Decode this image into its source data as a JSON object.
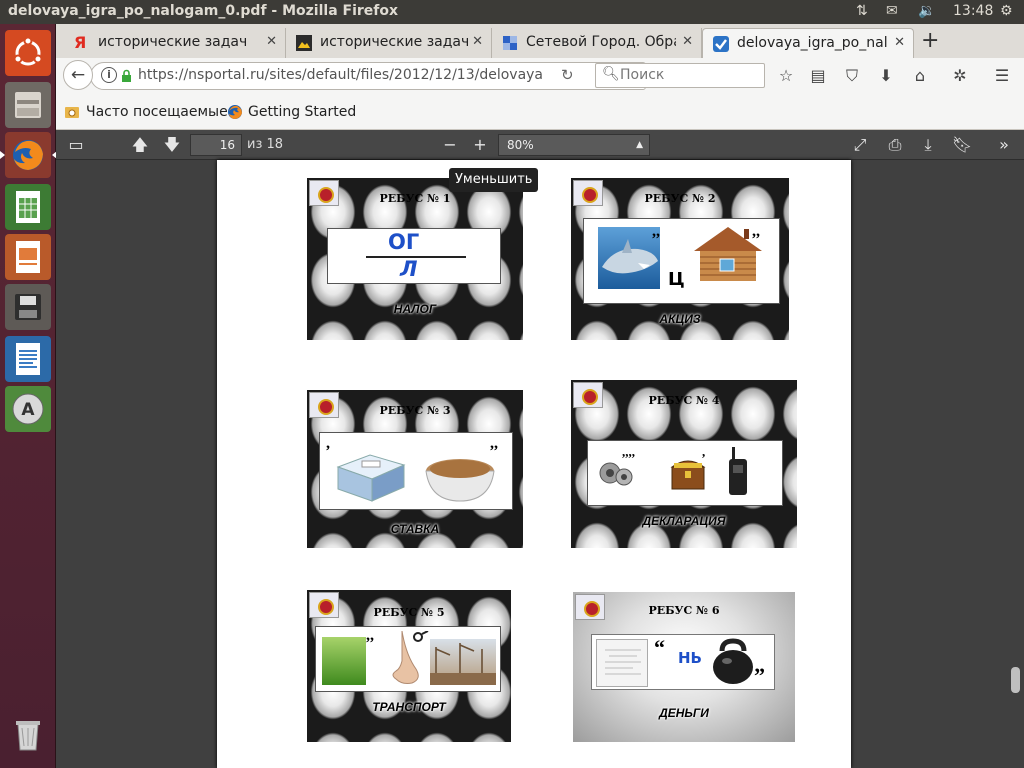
{
  "top_panel": {
    "window_title": "delovaya_igra_po_nalogam_0.pdf - Mozilla Firefox",
    "time": "13:48"
  },
  "launcher": {
    "items": [
      "ubuntu-dash",
      "files",
      "firefox",
      "libreoffice-calc",
      "libreoffice-impress",
      "save-disk",
      "libreoffice-writer",
      "software-updater",
      "trash"
    ]
  },
  "tabs": [
    {
      "label": "исторические задачи",
      "favicon": "yandex-icon"
    },
    {
      "label": "исторические задачи",
      "favicon": "image-icon"
    },
    {
      "label": "Сетевой Город. Образ",
      "favicon": "netcity-icon"
    },
    {
      "label": "delovaya_igra_po_nalo",
      "favicon": "pdf-check-icon",
      "active": true
    }
  ],
  "navbar": {
    "url": "https://nsportal.ru/sites/default/files/2012/12/13/delovaya",
    "search_placeholder": "Поиск"
  },
  "bookmarks": {
    "items": [
      {
        "label": "Часто посещаемые",
        "icon": "gear-folder-icon"
      },
      {
        "label": "Getting Started",
        "icon": "firefox-icon"
      }
    ]
  },
  "pdf_toolbar": {
    "page_number": "16",
    "page_total": "из 18",
    "zoom": "80%"
  },
  "tooltip": "Уменьшить",
  "slides": [
    {
      "title": "РЕБУС № 1",
      "answer": "НАЛОГ",
      "top_text": "ОГ",
      "bottom_text": "Л"
    },
    {
      "title": "РЕБУС № 2",
      "answer": "АКЦИЗ",
      "letter": "Ц",
      "comma_left": ",,",
      "comma_right": ",,"
    },
    {
      "title": "РЕБУС № 3",
      "answer": "СТАВКА",
      "comma_left": ",",
      "comma_right": ",,"
    },
    {
      "title": "РЕБУС № 4",
      "answer": "ДЕКЛАРАЦИЯ",
      "comma_left": ",,,,",
      "comma_right": ","
    },
    {
      "title": "РЕБУС № 5",
      "answer": "ТРАНСПОРТ",
      "comma_left": ",,"
    },
    {
      "title": "РЕБУС № 6",
      "answer": "ДЕНЬГИ",
      "letters": "НЬ",
      "quote_left": "“",
      "quote_right": "”"
    }
  ],
  "colors": {
    "panel": "#3c3b37",
    "launcher": "#5b2734",
    "pdf_toolbar": "#474747",
    "viewer_bg": "#404040",
    "rebus_blue": "#1e50c8"
  }
}
